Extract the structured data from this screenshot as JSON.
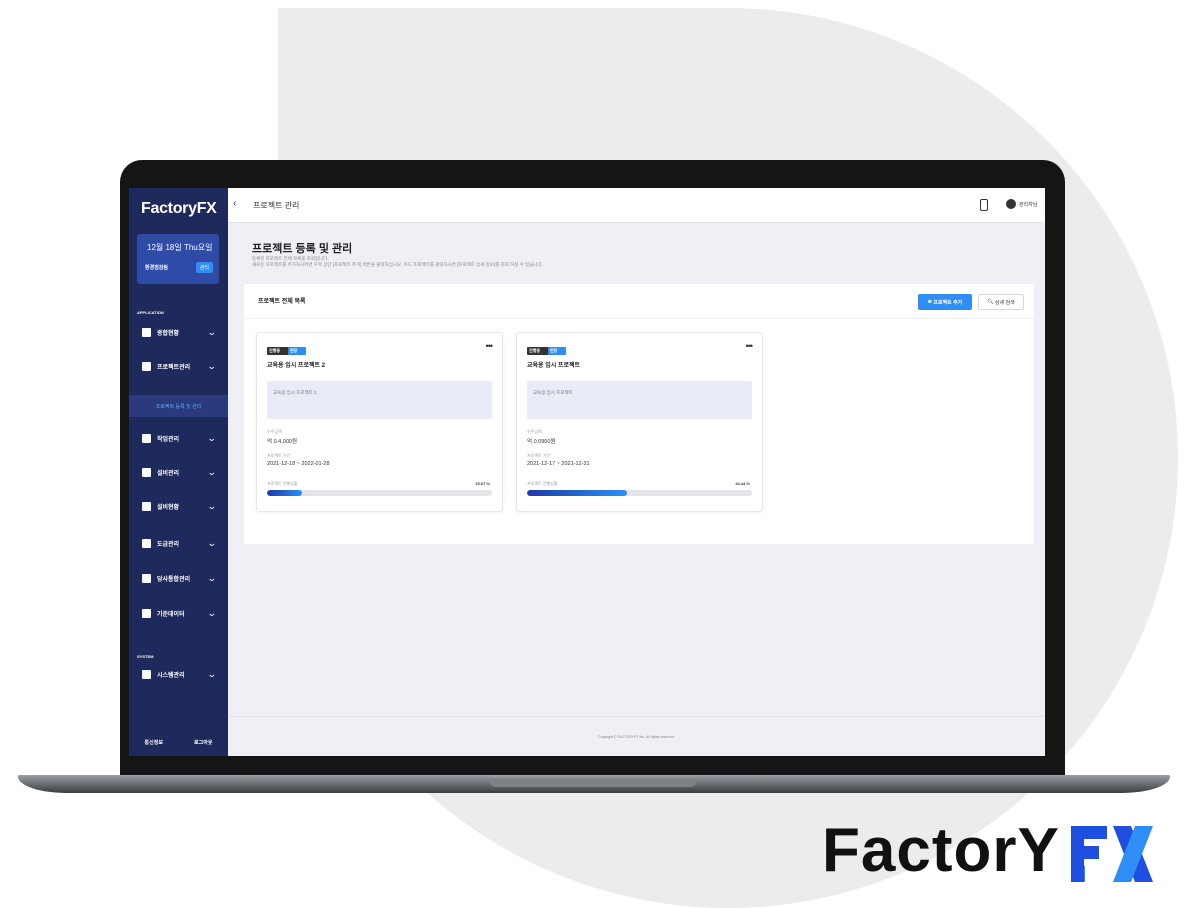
{
  "app": {
    "brand_text": "Factory",
    "brand_fx": "FX",
    "colors": {
      "sidebar": "#1f2a5c",
      "accent": "#2f8df6",
      "badge_blue": "#2a3a7c"
    }
  },
  "sidebar": {
    "logo_word": "Factory",
    "logo_fx": "FX",
    "user_name": "12월 18일 Thu요일",
    "user_role": "환경점검팀",
    "user_badge": "관리",
    "section_app": "APPLICATION",
    "section_system": "SYSTEM",
    "items": [
      {
        "label": "종합현황",
        "icon": "doc-icon"
      },
      {
        "label": "프로젝트관리",
        "icon": "folder-icon"
      },
      {
        "label": "작업관리",
        "icon": "task-icon"
      },
      {
        "label": "설비관리",
        "icon": "tool-icon"
      },
      {
        "label": "설비현황",
        "icon": "chart-icon"
      },
      {
        "label": "도급관리",
        "icon": "home-icon"
      },
      {
        "label": "당사통합관리",
        "icon": "list-icon"
      },
      {
        "label": "기준데이터",
        "icon": "gear-icon"
      },
      {
        "label": "시스템관리",
        "icon": "user-icon"
      }
    ],
    "submenu_label": "프로젝트 등록 및 관리",
    "footer_left": "통신정보",
    "footer_right": "로그아웃"
  },
  "topbar": {
    "title": "프로젝트 관리",
    "user": "관리자님"
  },
  "main": {
    "page_title": "프로젝트 등록 및 관리",
    "page_desc_1": "등록된 프로젝트 전체 목록을 조회합니다.",
    "page_desc_2": "새로운 프로젝트를 추가하시려면 우측 상단 [프로젝트 추가] 버튼을 클릭하십시오. 카드 프로젝트를 클릭하시면 [프로젝트 상세 정보]를 조회 하실 수 있습니다.",
    "panel_title": "프로젝트 전체 목록",
    "add_button": "프로젝트 추가",
    "search_button": "상세 검색"
  },
  "cards": [
    {
      "tag1": "진행중",
      "tag2": "현장",
      "title": "교육용 임시 프로젝트 2",
      "memo": "교육용 임시 프로젝트 2",
      "label1": "수주금액",
      "value1": "억 0.4,000원",
      "label2": "프로젝트 기간",
      "value2": "2021-12-18 ~ 2022-01-28",
      "label3": "프로젝트 진행상황",
      "progress_text": "15.67 %",
      "progress": 0.1567
    },
    {
      "tag1": "진행중",
      "tag2": "현장",
      "title": "교육용 임시 프로젝트",
      "memo": "교육용 임시 프로젝트",
      "label1": "수주금액",
      "value1": "억 0.0900원",
      "label2": "프로젝트 기간",
      "value2": "2021-12-17 ~ 2021-12-31",
      "label3": "프로젝트 진행상황",
      "progress_text": "44.44 %",
      "progress": 0.4444
    }
  ],
  "footer": {
    "copyright": "Copyright © FACTORYFX Inc. All rights reserved."
  },
  "brand_bottom": {
    "word": "FactorY",
    "fx": "FX"
  }
}
